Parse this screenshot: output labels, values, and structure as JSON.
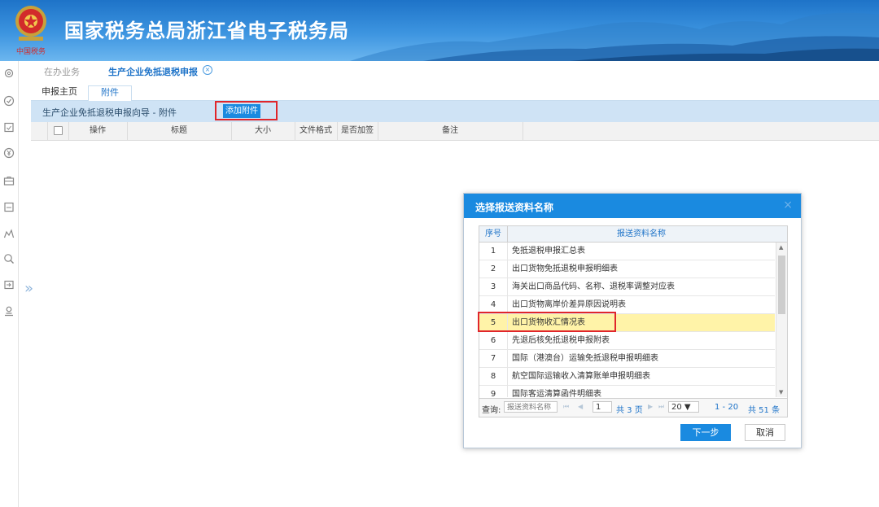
{
  "header": {
    "title": "国家税务总局浙江省电子税务局"
  },
  "tabs": {
    "office": "在办业务",
    "current": "生产企业免抵退税申报",
    "close_icon": "close-circle-icon"
  },
  "subtabs": {
    "home": "申报主页",
    "attachment": "附件"
  },
  "wizard": {
    "title": "生产企业免抵退税申报向导 - 附件",
    "add_button": "添加附件"
  },
  "grid": {
    "columns": [
      "操作",
      "标题",
      "大小",
      "文件格式",
      "是否加签",
      "备注"
    ]
  },
  "sidebar": {
    "icons": [
      "gear-icon",
      "check-circle-icon",
      "calendar-check-icon",
      "yen-circle-icon",
      "briefcase-icon",
      "calendar-icon",
      "chart-icon",
      "search-icon",
      "login-icon",
      "user-icon"
    ],
    "expand": "»"
  },
  "dialog": {
    "title": "选择报送资料名称",
    "close": "×",
    "columns": {
      "no": "序号",
      "name": "报送资料名称"
    },
    "rows": [
      {
        "no": "1",
        "name": "免抵退税申报汇总表"
      },
      {
        "no": "2",
        "name": "出口货物免抵退税申报明细表"
      },
      {
        "no": "3",
        "name": "海关出口商品代码、名称、退税率调整对应表"
      },
      {
        "no": "4",
        "name": "出口货物离岸价差异原因说明表"
      },
      {
        "no": "5",
        "name": "出口货物收汇情况表"
      },
      {
        "no": "6",
        "name": "先退后核免抵退税申报附表"
      },
      {
        "no": "7",
        "name": "国际（港澳台）运输免抵退税申报明细表"
      },
      {
        "no": "8",
        "name": "航空国际运输收入清算账单申报明细表"
      },
      {
        "no": "9",
        "name": "国际客运清算函件明细表"
      }
    ],
    "selected_row": 5,
    "pager": {
      "query_label": "查询:",
      "query_placeholder": "报送资料名称",
      "first": "⏮",
      "prev": "◀",
      "page": "1",
      "total_pages": "共 3 页",
      "next": "▶",
      "last": "⏭",
      "page_size": "20 ▼",
      "range": "1 - 20",
      "total": "共 51 条"
    },
    "next_button": "下一步",
    "cancel_button": "取消"
  },
  "colors": {
    "brand": "#1a8ae0",
    "highlight": "#fff3a8",
    "annotation": "#e0262b"
  }
}
